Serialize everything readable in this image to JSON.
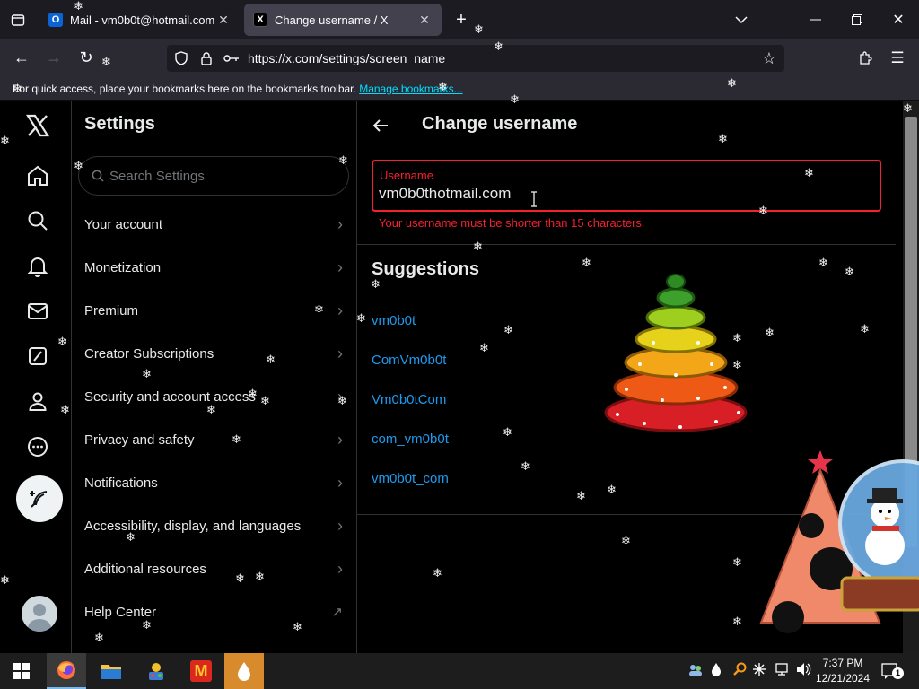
{
  "browser": {
    "tabs": [
      {
        "title": "Mail - vm0b0t@hotmail.com -",
        "favicon_letter": "O",
        "active": false
      },
      {
        "title": "Change username / X",
        "favicon_letter": "X",
        "active": true
      }
    ],
    "url": "https://x.com/settings/screen_name",
    "bookmarks_message": "For quick access, place your bookmarks here on the bookmarks toolbar.",
    "bookmarks_link": "Manage bookmarks..."
  },
  "settings": {
    "title": "Settings",
    "search_placeholder": "Search Settings",
    "items": [
      {
        "label": "Your account",
        "icon": "chevron-right-icon"
      },
      {
        "label": "Monetization",
        "icon": "chevron-right-icon"
      },
      {
        "label": "Premium",
        "icon": "chevron-right-icon"
      },
      {
        "label": "Creator Subscriptions",
        "icon": "chevron-right-icon"
      },
      {
        "label": "Security and account access",
        "icon": "chevron-right-icon"
      },
      {
        "label": "Privacy and safety",
        "icon": "chevron-right-icon"
      },
      {
        "label": "Notifications",
        "icon": "chevron-right-icon"
      },
      {
        "label": "Accessibility, display, and languages",
        "icon": "chevron-right-icon"
      },
      {
        "label": "Additional resources",
        "icon": "chevron-right-icon"
      },
      {
        "label": "Help Center",
        "icon": "external-link-icon"
      }
    ]
  },
  "main": {
    "title": "Change username",
    "field_label": "Username",
    "field_value": "vm0b0thotmail.com",
    "error": "Your username must be shorter than 15 characters.",
    "suggestions_title": "Suggestions",
    "suggestions": [
      "vm0b0t",
      "ComVm0b0t",
      "Vm0b0tCom",
      "com_vm0b0t",
      "vm0b0t_com"
    ]
  },
  "taskbar": {
    "time": "7:37 PM",
    "date": "12/21/2024",
    "notification_count": "1"
  },
  "colors": {
    "accent_blue": "#1d9bf0",
    "error_red": "#f4212e",
    "border": "#2f3336"
  }
}
